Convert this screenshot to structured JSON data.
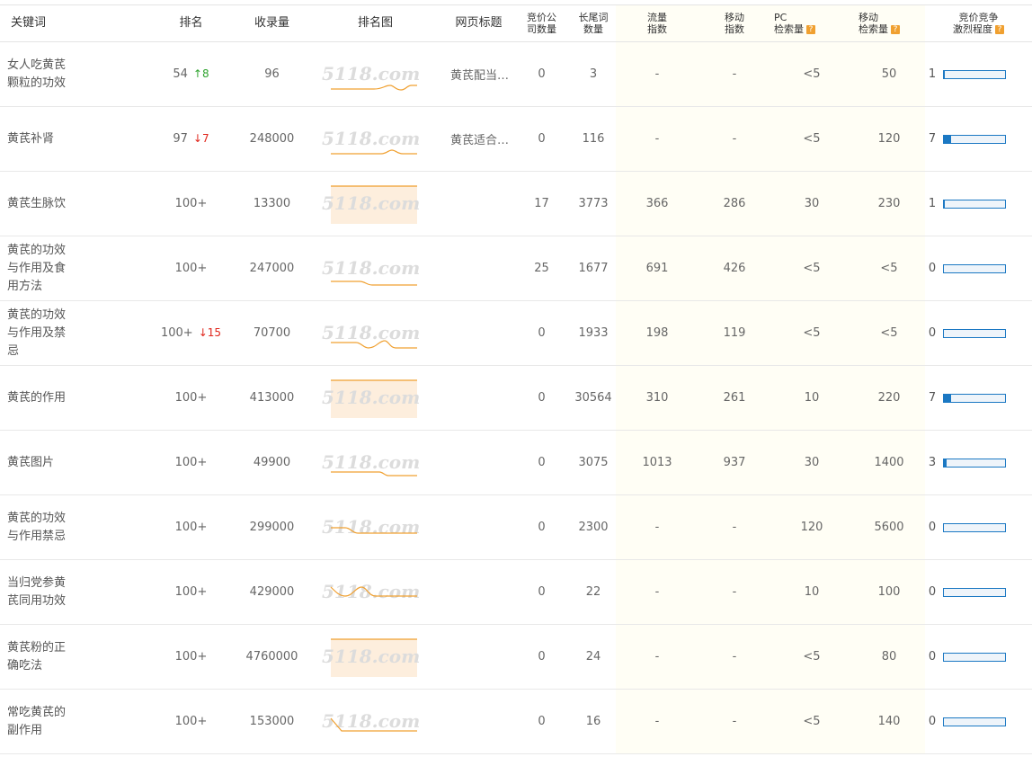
{
  "headers": {
    "keyword": "关键词",
    "rank": "排名",
    "indexed": "收录量",
    "rank_chart": "排名图",
    "page_title": "网页标题",
    "bid_companies": [
      "竞价公",
      "司数量"
    ],
    "long_tail": [
      "长尾词",
      "数量"
    ],
    "traffic_index": [
      "流量",
      "指数"
    ],
    "mobile_index": [
      "移动",
      "指数"
    ],
    "pc_search": [
      "PC",
      "检索量"
    ],
    "mobile_search": [
      "移动",
      "检索量"
    ],
    "competition": [
      "竞价竞争",
      "激烈程度"
    ],
    "help_glyph": "?"
  },
  "watermark": "5118.com",
  "colors": {
    "link": "#1b78c3",
    "up": "#2ea32e",
    "down": "#e0251b",
    "spark": "#f0a030",
    "spark_fill": "#fdeedd"
  },
  "rows": [
    {
      "keyword": [
        "女人吃黄芪",
        "颗粒的功效"
      ],
      "rank": "54",
      "rank_change": "8",
      "change_dir": "up",
      "indexed": "96",
      "title": "黄芪配当…",
      "bid": "0",
      "long_tail": "3",
      "traffic": "-",
      "mobile": "-",
      "pc": "<5",
      "mobile_search": "50",
      "comp": "1",
      "comp_level": 0.02,
      "spark": "a"
    },
    {
      "keyword": [
        "黄芪补肾"
      ],
      "rank": "97",
      "rank_change": "7",
      "change_dir": "down",
      "indexed": "248000",
      "title": "黄芪适合…",
      "bid": "0",
      "long_tail": "116",
      "traffic": "-",
      "mobile": "-",
      "pc": "<5",
      "mobile_search": "120",
      "comp": "7",
      "comp_level": 0.12,
      "spark": "b"
    },
    {
      "keyword": [
        "黄芪生脉饮"
      ],
      "rank": "100+",
      "rank_change": "",
      "change_dir": "",
      "indexed": "13300",
      "title": "",
      "bid": "17",
      "long_tail": "3773",
      "traffic": "366",
      "mobile": "286",
      "pc": "30",
      "mobile_search": "230",
      "comp": "1",
      "comp_level": 0.02,
      "spark": "flat"
    },
    {
      "keyword": [
        "黄芪的功效",
        "与作用及食",
        "用方法"
      ],
      "rank": "100+",
      "rank_change": "",
      "change_dir": "",
      "indexed": "247000",
      "title": "",
      "bid": "25",
      "long_tail": "1677",
      "traffic": "691",
      "mobile": "426",
      "pc": "<5",
      "mobile_search": "<5",
      "comp": "0",
      "comp_level": 0,
      "spark": "c"
    },
    {
      "keyword": [
        "黄芪的功效",
        "与作用及禁",
        "忌"
      ],
      "rank": "100+",
      "rank_change": "15",
      "change_dir": "down",
      "indexed": "70700",
      "title": "",
      "bid": "0",
      "long_tail": "1933",
      "traffic": "198",
      "mobile": "119",
      "pc": "<5",
      "mobile_search": "<5",
      "comp": "0",
      "comp_level": 0,
      "spark": "d"
    },
    {
      "keyword": [
        "黄芪的作用"
      ],
      "rank": "100+",
      "rank_change": "",
      "change_dir": "",
      "indexed": "413000",
      "title": "",
      "bid": "0",
      "long_tail": "30564",
      "traffic": "310",
      "mobile": "261",
      "pc": "10",
      "mobile_search": "220",
      "comp": "7",
      "comp_level": 0.12,
      "spark": "flat"
    },
    {
      "keyword": [
        "黄芪图片"
      ],
      "rank": "100+",
      "rank_change": "",
      "change_dir": "",
      "indexed": "49900",
      "title": "",
      "bid": "0",
      "long_tail": "3075",
      "traffic": "1013",
      "mobile": "937",
      "pc": "30",
      "mobile_search": "1400",
      "comp": "3",
      "comp_level": 0.05,
      "spark": "e"
    },
    {
      "keyword": [
        "黄芪的功效",
        "与作用禁忌"
      ],
      "rank": "100+",
      "rank_change": "",
      "change_dir": "",
      "indexed": "299000",
      "title": "",
      "bid": "0",
      "long_tail": "2300",
      "traffic": "-",
      "mobile": "-",
      "pc": "120",
      "mobile_search": "5600",
      "comp": "0",
      "comp_level": 0,
      "spark": "f"
    },
    {
      "keyword": [
        "当归党参黄",
        "芪同用功效"
      ],
      "rank": "100+",
      "rank_change": "",
      "change_dir": "",
      "indexed": "429000",
      "title": "",
      "bid": "0",
      "long_tail": "22",
      "traffic": "-",
      "mobile": "-",
      "pc": "10",
      "mobile_search": "100",
      "comp": "0",
      "comp_level": 0,
      "spark": "g"
    },
    {
      "keyword": [
        "黄芪粉的正",
        "确吃法"
      ],
      "rank": "100+",
      "rank_change": "",
      "change_dir": "",
      "indexed": "4760000",
      "title": "",
      "bid": "0",
      "long_tail": "24",
      "traffic": "-",
      "mobile": "-",
      "pc": "<5",
      "mobile_search": "80",
      "comp": "0",
      "comp_level": 0,
      "spark": "flat"
    },
    {
      "keyword": [
        "常吃黄芪的",
        "副作用"
      ],
      "rank": "100+",
      "rank_change": "",
      "change_dir": "",
      "indexed": "153000",
      "title": "",
      "bid": "0",
      "long_tail": "16",
      "traffic": "-",
      "mobile": "-",
      "pc": "<5",
      "mobile_search": "140",
      "comp": "0",
      "comp_level": 0,
      "spark": "h"
    }
  ]
}
